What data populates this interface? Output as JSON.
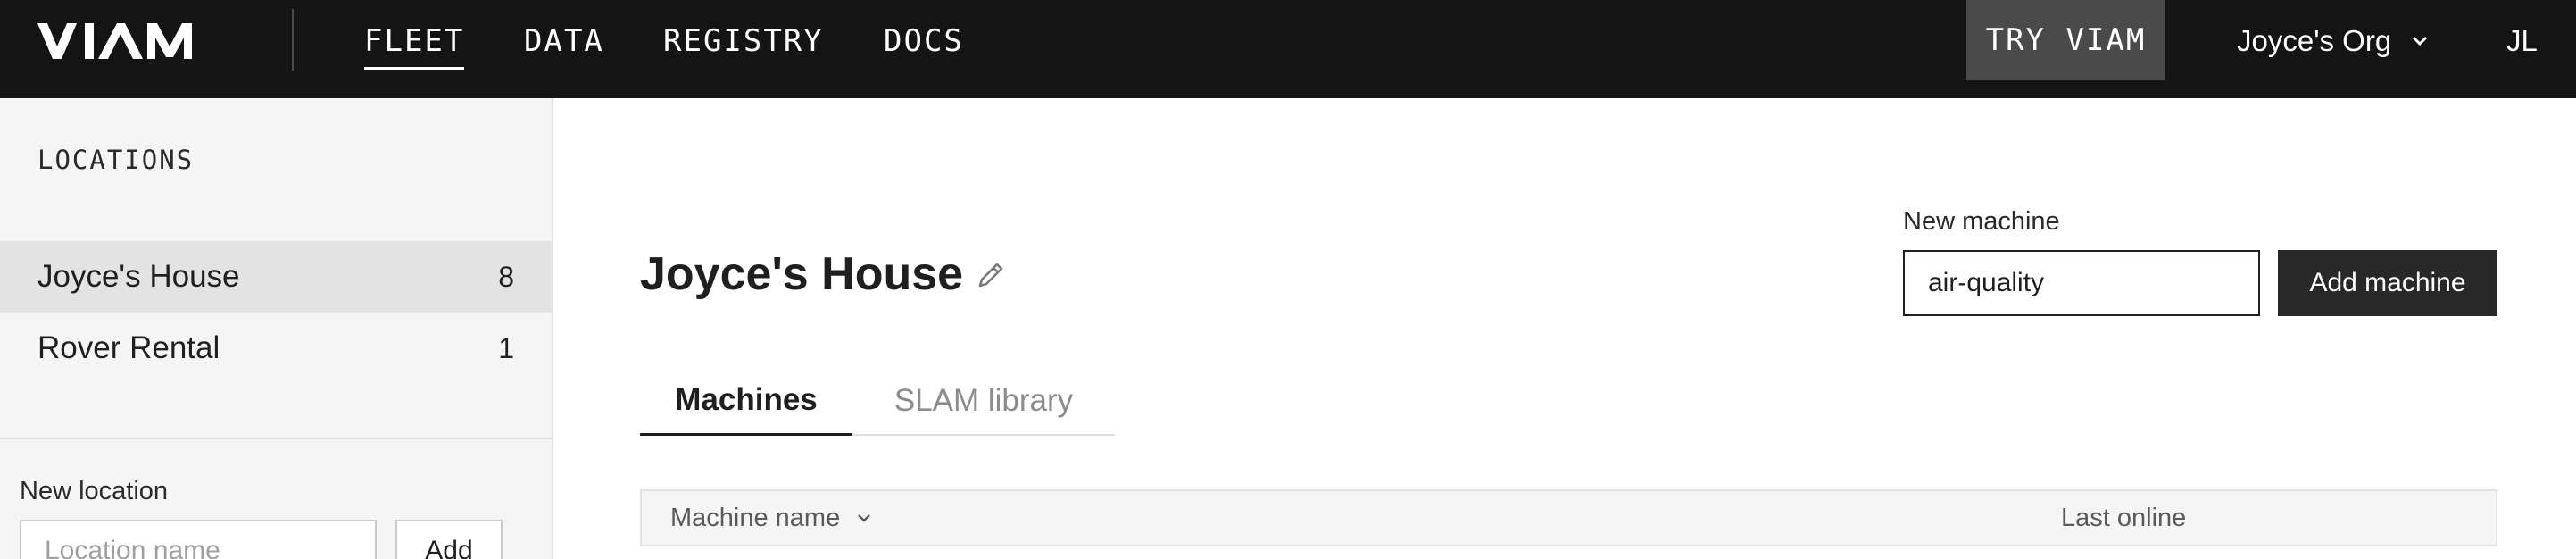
{
  "header": {
    "logo_text": "VIAM",
    "nav": [
      {
        "label": "FLEET",
        "active": true
      },
      {
        "label": "DATA",
        "active": false
      },
      {
        "label": "REGISTRY",
        "active": false
      },
      {
        "label": "DOCS",
        "active": false
      }
    ],
    "try_label": "TRY VIAM",
    "org_name": "Joyce's Org",
    "org_icon": "chevron-down-icon",
    "user_initials": "JL"
  },
  "sidebar": {
    "heading": "LOCATIONS",
    "locations": [
      {
        "name": "Joyce's House",
        "count": "8",
        "active": true
      },
      {
        "name": "Rover Rental",
        "count": "1",
        "active": false
      }
    ],
    "new_location_label": "New location",
    "location_placeholder": "Location name",
    "add_label": "Add"
  },
  "main": {
    "title": "Joyce's House",
    "edit_icon": "pencil-icon",
    "new_machine_label": "New machine",
    "new_machine_value": "air-quality",
    "add_machine_label": "Add machine",
    "tabs": [
      {
        "label": "Machines",
        "active": true
      },
      {
        "label": "SLAM library",
        "active": false
      }
    ],
    "table": {
      "columns": [
        "Machine name",
        "Last online"
      ],
      "sort_icon": "chevron-down-icon"
    }
  },
  "colors": {
    "topbar_bg": "#141414",
    "try_bg": "#4a4a4a",
    "sidebar_bg": "#f5f5f5",
    "active_row_bg": "#e3e3e3",
    "primary_button_bg": "#282828"
  }
}
